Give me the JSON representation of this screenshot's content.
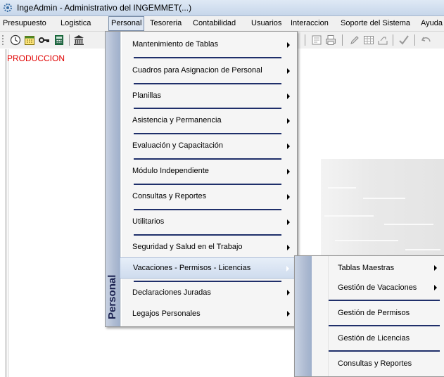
{
  "window": {
    "title": "IngeAdmin -  Administrativo del INGEMMET(...)"
  },
  "menubar": [
    {
      "label": "Presupuesto",
      "key": "P"
    },
    {
      "label": "Logistica",
      "key": "L"
    },
    {
      "label": "Personal",
      "key": "e",
      "active": true
    },
    {
      "label": "Tesoreria",
      "key": "T"
    },
    {
      "label": "Contabilidad",
      "key": "C"
    },
    {
      "label": "Usuarios",
      "key": "U"
    },
    {
      "label": "Interaccion"
    },
    {
      "label": "Soporte del Sistema"
    },
    {
      "label": "Ayuda"
    }
  ],
  "toolbar": {
    "icons": [
      "clock-icon",
      "calendar-icon",
      "key-icon",
      "calculator-icon",
      "bank-icon",
      "preview-icon",
      "print-icon",
      "edit-icon",
      "grid-icon",
      "export-icon",
      "check-icon",
      "undo-icon"
    ]
  },
  "status": {
    "environment": "PRODUCCION"
  },
  "personal_menu": {
    "band_label": "Personal",
    "items": [
      {
        "label": "Mantenimiento de Tablas",
        "submenu": true
      },
      {
        "label": "Cuadros para Asignacion de Personal",
        "submenu": true
      },
      {
        "label": "Planillas",
        "submenu": true
      },
      {
        "label": "Asistencia y Permanencia",
        "submenu": true
      },
      {
        "label": "Evaluación y Capacitación",
        "submenu": true
      },
      {
        "label": "Módulo Independiente",
        "submenu": true
      },
      {
        "label": "Consultas y Reportes",
        "submenu": true
      },
      {
        "label": "Utilitarios",
        "submenu": true
      },
      {
        "label": "Seguridad y Salud en el Trabajo",
        "submenu": true
      },
      {
        "label": "Vacaciones - Permisos - Licencias",
        "submenu": true,
        "highlighted": true
      },
      {
        "label": "Declaraciones Juradas",
        "submenu": true
      },
      {
        "label": "Legajos Personales",
        "submenu": true
      }
    ]
  },
  "vacaciones_submenu": {
    "items": [
      {
        "label": "Tablas Maestras",
        "submenu": true
      },
      {
        "label": "Gestión de Vacaciones",
        "submenu": true
      },
      {
        "label": "Gestión de Permisos",
        "submenu": false
      },
      {
        "label": "Gestión de Licencias",
        "submenu": false
      },
      {
        "label": "Consultas y Reportes",
        "submenu": false
      }
    ]
  },
  "colors": {
    "accent": "#1f2f6a",
    "highlight": "#cfdcee",
    "production_text": "#e00000"
  }
}
